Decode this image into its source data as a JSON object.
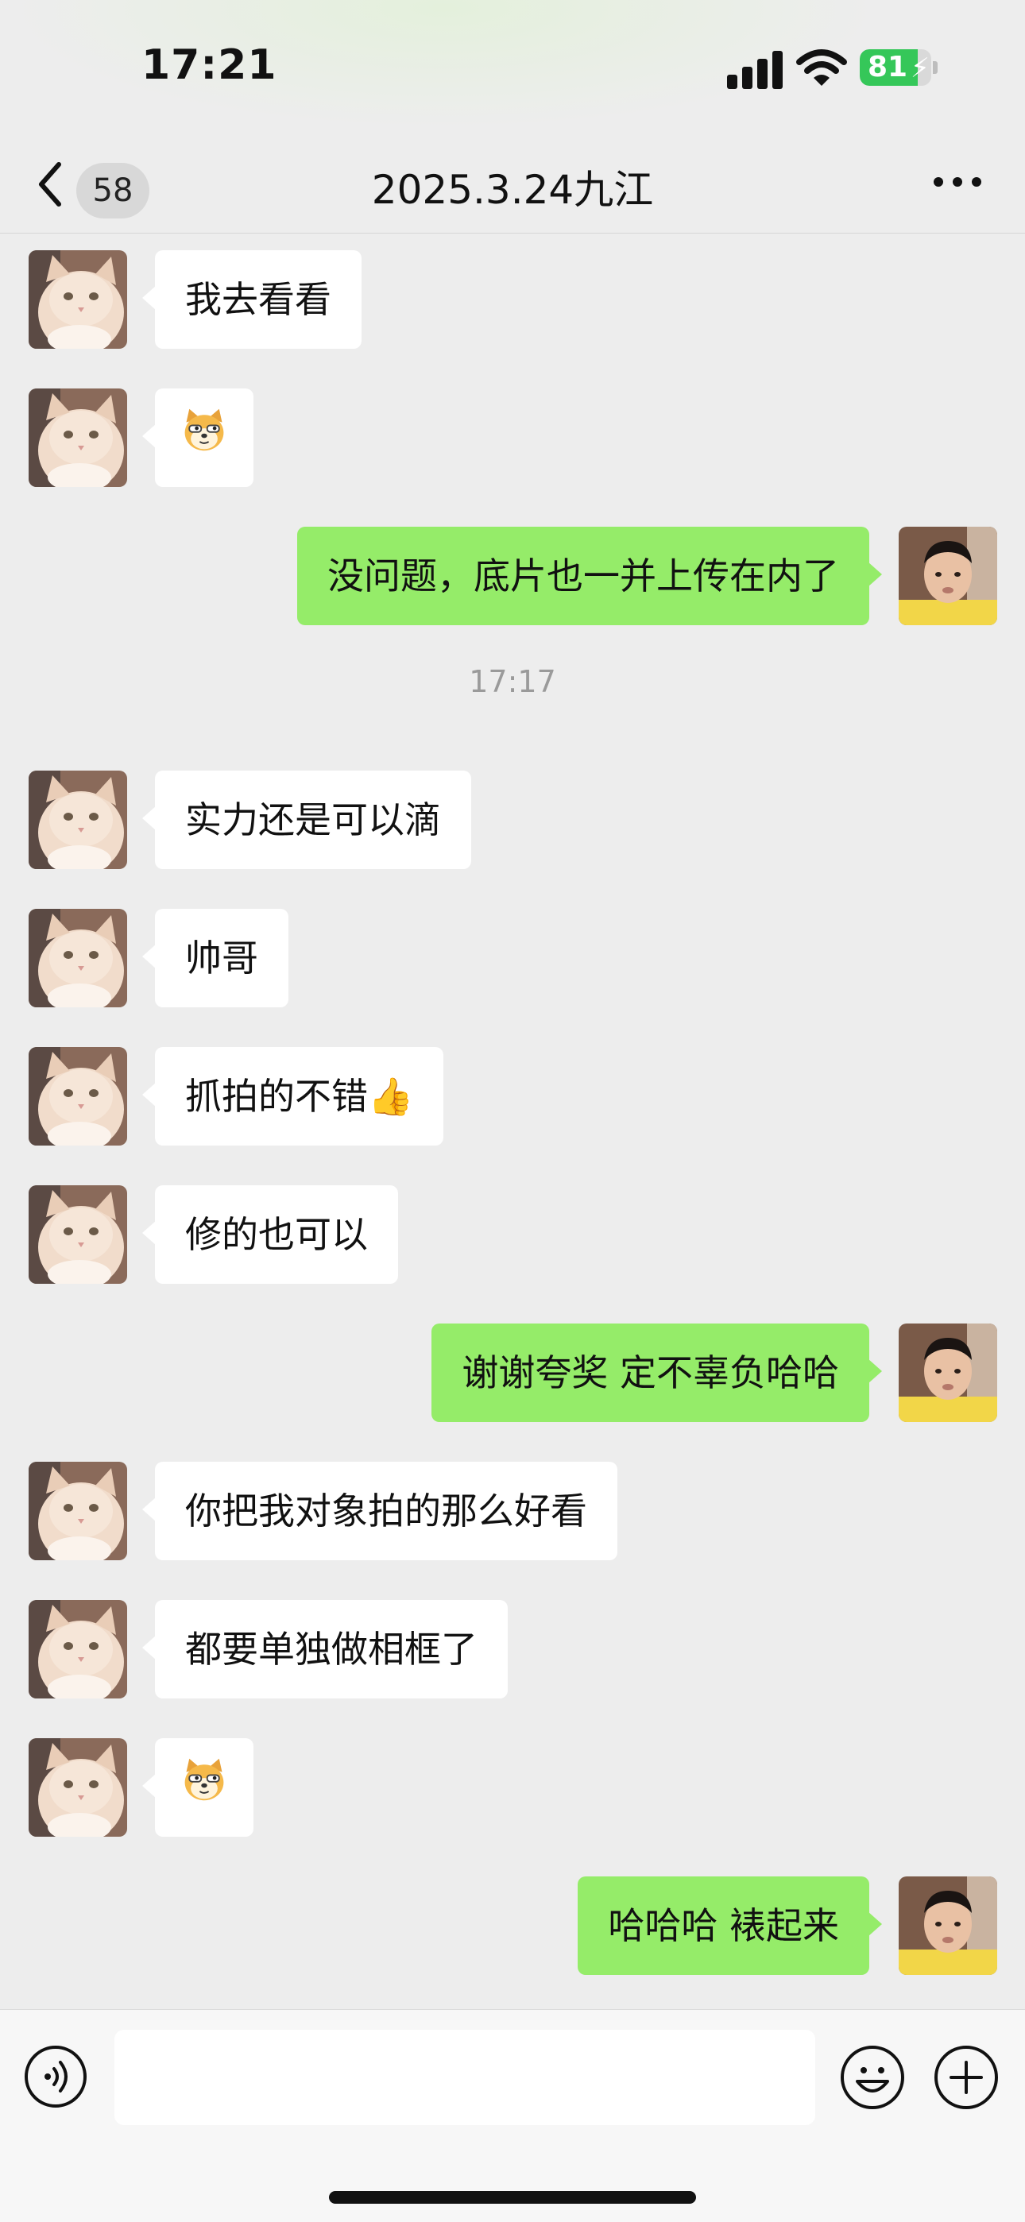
{
  "status_bar": {
    "time": "17:21",
    "battery_percent": "81",
    "battery_level": 0.81,
    "icons": [
      "signal-icon",
      "wifi-icon",
      "battery-charging-icon"
    ]
  },
  "nav": {
    "back_icon": "chevron-left-icon",
    "unread_count": "58",
    "title": "2025.3.24九江",
    "more_icon": "more-dots-icon"
  },
  "colors": {
    "background": "#EDEDED",
    "incoming_bubble": "#FFFFFF",
    "outgoing_bubble": "#95EC69",
    "timestamp": "#9A9A9A"
  },
  "messages": [
    {
      "side": "in",
      "text": "我去看看"
    },
    {
      "side": "in",
      "text": "",
      "sticker": "doge-emoji"
    },
    {
      "side": "out",
      "text": "没问题，底片也一并上传在内了"
    },
    {
      "timestamp": "17:17"
    },
    {
      "side": "in",
      "text": "实力还是可以滴"
    },
    {
      "side": "in",
      "text": "帅哥"
    },
    {
      "side": "in",
      "text": "抓拍的不错👍"
    },
    {
      "side": "in",
      "text": "修的也可以"
    },
    {
      "side": "out",
      "text": "谢谢夸奖 定不辜负哈哈"
    },
    {
      "side": "in",
      "text": "你把我对象拍的那么好看"
    },
    {
      "side": "in",
      "text": "都要单独做相框了"
    },
    {
      "side": "in",
      "text": "",
      "sticker": "doge-emoji"
    },
    {
      "side": "out",
      "text": "哈哈哈 裱起来"
    }
  ],
  "input_bar": {
    "voice_icon": "voice-icon",
    "input_value": "",
    "emoji_icon": "emoji-face-icon",
    "plus_icon": "plus-icon"
  }
}
